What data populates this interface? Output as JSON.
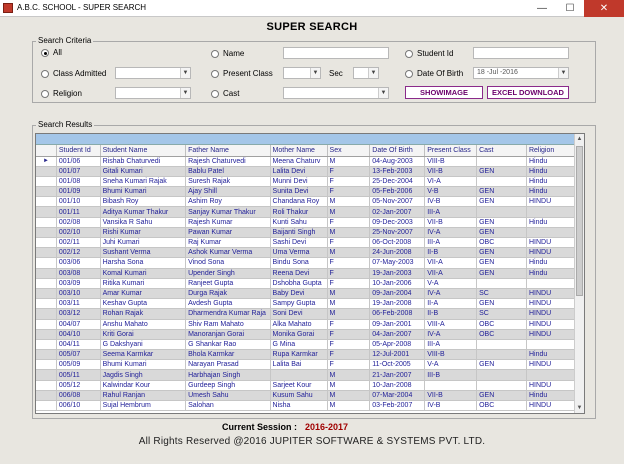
{
  "window": {
    "title": "A.B.C. SCHOOL - SUPER SEARCH",
    "minimize": "—",
    "maximize": "☐",
    "close": "✕"
  },
  "page": {
    "title": "SUPER SEARCH"
  },
  "criteria": {
    "label": "Search Criteria",
    "all": "All",
    "class_admitted": "Class Admitted",
    "religion": "Religion",
    "name": "Name",
    "present_class": "Present Class",
    "sec": "Sec",
    "cast": "Cast",
    "student_id": "Student Id",
    "date_of_birth": "Date Of Birth",
    "dob_value": "18 -Jul -2016",
    "selected": "All"
  },
  "buttons": {
    "show_image": "SHOWIMAGE",
    "excel_download": "EXCEL DOWNLOAD"
  },
  "results": {
    "label": "Search Results",
    "columns": [
      "Student Id",
      "Student Name",
      "Father Name",
      "Mother Name",
      "Sex",
      "Date Of Birth",
      "Present Class",
      "Cast",
      "Religion"
    ],
    "rows": [
      [
        "001/06",
        "Rishab Chaturvedi",
        "Rajesh Chaturvedi",
        "Meena Chaturv",
        "M",
        "04-Aug-2003",
        "VIII-B",
        "",
        "Hindu"
      ],
      [
        "001/07",
        "Gitali Kumari",
        "Bablu Patel",
        "Lalita Devi",
        "F",
        "13-Feb-2003",
        "VII-B",
        "GEN",
        "Hindu"
      ],
      [
        "001/08",
        "Sneha Kumari Rajak",
        "Suresh Rajak",
        "Munni Devi",
        "F",
        "25-Dec-2004",
        "VI-A",
        "",
        "Hindu"
      ],
      [
        "001/09",
        "Bhumi Kumari",
        "Ajay Shill",
        "Sunita Devi",
        "F",
        "05-Feb-2006",
        "V-B",
        "GEN",
        "Hindu"
      ],
      [
        "001/10",
        "Bibash Roy",
        "Ashim Roy",
        "Chandana Roy",
        "M",
        "05-Nov-2007",
        "IV-B",
        "GEN",
        "HINDU"
      ],
      [
        "001/11",
        "Aditya Kumar Thakur",
        "Sanjay Kumar Thakur",
        "Roli Thakur",
        "M",
        "02-Jan-2007",
        "III-A",
        "",
        ""
      ],
      [
        "002/08",
        "Vansika R Sahu",
        "Rajesh Kumar",
        "Kunti Sahu",
        "F",
        "09-Dec-2003",
        "VII-B",
        "GEN",
        "Hindu"
      ],
      [
        "002/10",
        "Rishi Kumar",
        "Pawan Kumar",
        "Baijanti Singh",
        "M",
        "25-Nov-2007",
        "IV-A",
        "GEN",
        ""
      ],
      [
        "002/11",
        "Juhi Kumari",
        "Raj Kumar",
        "Sashi Devi",
        "F",
        "06-Oct-2008",
        "III-A",
        "OBC",
        "HINDU"
      ],
      [
        "002/12",
        "Sushant Verma",
        "Ashok Kumar Verma",
        "Uma Verma",
        "M",
        "24-Jun-2008",
        "II-B",
        "GEN",
        "HINDU"
      ],
      [
        "003/06",
        "Harsha Sona",
        "Vinod Sona",
        "Bindu Sona",
        "F",
        "07-May-2003",
        "VII-A",
        "GEN",
        "Hindu"
      ],
      [
        "003/08",
        "Komal Kumari",
        "Upender Singh",
        "Reena Devi",
        "F",
        "19-Jan-2003",
        "VII-A",
        "GEN",
        "Hindu"
      ],
      [
        "003/09",
        "Ritika Kumari",
        "Ranjeet Gupta",
        "Dshobha Gupta",
        "F",
        "10-Jan-2006",
        "V-A",
        "",
        ""
      ],
      [
        "003/10",
        "Amar Kumar",
        "Durga Rajak",
        "Baby Devi",
        "M",
        "09-Jan-2004",
        "IV-A",
        "SC",
        "HINDU"
      ],
      [
        "003/11",
        "Keshav Gupta",
        "Avdesh Gupta",
        "Sampy Gupta",
        "M",
        "19-Jan-2008",
        "II-A",
        "GEN",
        "HINDU"
      ],
      [
        "003/12",
        "Rohan Rajak",
        "Dharmendra Kumar Raja",
        "Soni Devi",
        "M",
        "06-Feb-2008",
        "II-B",
        "SC",
        "HINDU"
      ],
      [
        "004/07",
        "Anshu Mahato",
        "Shiv Ram Mahato",
        "Alka Mahato",
        "F",
        "09-Jan-2001",
        "VIII-A",
        "OBC",
        "HINDU"
      ],
      [
        "004/10",
        "Kriti Gorai",
        "Manoranjan Gorai",
        "Monika Gorai",
        "F",
        "04-Jan-2007",
        "IV-A",
        "OBC",
        "HINDU"
      ],
      [
        "004/11",
        "G Dakshyani",
        "G Shankar Rao",
        "G Mina",
        "F",
        "05-Apr-2008",
        "III-A",
        "",
        ""
      ],
      [
        "005/07",
        "Seema Karmkar",
        "Bhola Karmkar",
        "Rupa Karmkar",
        "F",
        "12-Jul-2001",
        "VIII-B",
        "",
        "Hindu"
      ],
      [
        "005/09",
        "Bhumi Kumari",
        "Narayan Prasad",
        "Lalita Bai",
        "F",
        "11-Oct-2005",
        "V-A",
        "GEN",
        "HINDU"
      ],
      [
        "005/11",
        "Jagdis Singh",
        "Harbhajan Singh",
        "",
        "M",
        "21-Jan-2007",
        "III-B",
        "",
        ""
      ],
      [
        "005/12",
        "Kalwindar Kour",
        "Gurdeep Singh",
        "Sarjeet Kour",
        "M",
        "10-Jan-2008",
        "",
        "",
        "HINDU"
      ],
      [
        "006/08",
        "Rahul Ranjan",
        "Umesh Sahu",
        "Kusum Sahu",
        "M",
        "07-Mar-2004",
        "VII-B",
        "GEN",
        "Hindu"
      ],
      [
        "006/10",
        "Sujal Hembrum",
        "Salohan",
        "Nisha",
        "M",
        "03-Feb-2007",
        "IV-B",
        "OBC",
        "HINDU"
      ]
    ]
  },
  "session": {
    "label": "Current Session  :",
    "value": "2016-2017"
  },
  "footer": {
    "text": "All Rights Reserved @2016 JUPITER SOFTWARE & SYSTEMS PVT. LTD."
  },
  "colors": {
    "header_bar": "#a4c6e8",
    "grid_text": "#222199",
    "button_text": "#6b006b",
    "session_value": "#a00000"
  }
}
